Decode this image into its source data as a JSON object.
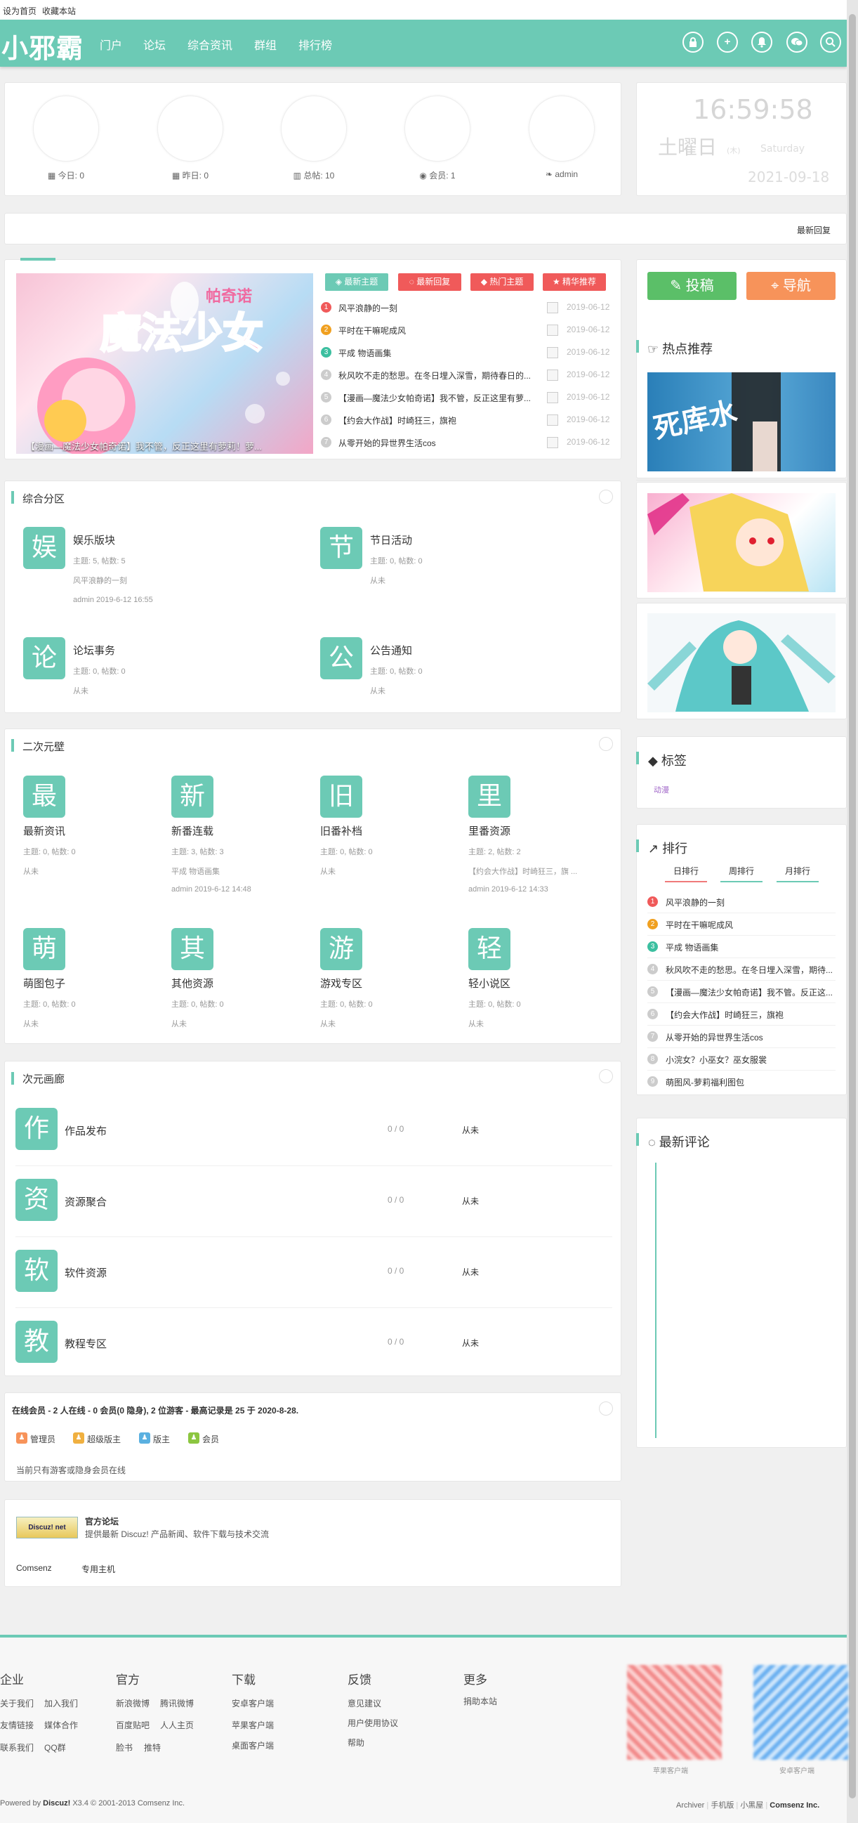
{
  "topbar": {
    "set_home": "设为首页",
    "bookmark": "收藏本站"
  },
  "header": {
    "logo": "小邪霸",
    "nav": [
      "门户",
      "论坛",
      "综合资讯",
      "群组",
      "排行榜"
    ],
    "icons": [
      "lock-icon",
      "plus-icon",
      "bell-icon",
      "chat-icon",
      "search-icon"
    ]
  },
  "stats": {
    "today": "今日: 0",
    "yesterday": "昨日: 0",
    "posts": "总帖: 10",
    "members": "会员: 1",
    "newest": "admin"
  },
  "clock": {
    "time": "16:59:58",
    "weekday_cn": "土曜日",
    "weekday_en": "Saturday",
    "paren": "(木)",
    "date": "2021-09-18"
  },
  "latest_reply_bar": {
    "label": "最新回复"
  },
  "hot_tabs": [
    "最新主题",
    "最新回复",
    "热门主题",
    "精华推荐"
  ],
  "banner": {
    "caption": "【漫画—魔法少女帕奇诺】我不管，反正这里有萝莉！萝..."
  },
  "hot_list": [
    {
      "title": "风平浪静的一刻",
      "date": "2019-06-12"
    },
    {
      "title": "平时在干嘛呢成风",
      "date": "2019-06-12"
    },
    {
      "title": "平成 物语画集",
      "date": "2019-06-12"
    },
    {
      "title": "秋风吹不走的愁思。在冬日埋入深雪，期待春日的...",
      "date": "2019-06-12"
    },
    {
      "title": "【漫画—魔法少女帕奇诺】我不管，反正这里有萝...",
      "date": "2019-06-12"
    },
    {
      "title": "【约会大作战】时崎狂三，旗袍",
      "date": "2019-06-12"
    },
    {
      "title": "从零开始的异世界生活cos",
      "date": "2019-06-12"
    }
  ],
  "section1": {
    "title": "综合分区",
    "forums": [
      {
        "icon": "娱",
        "name": "娱乐版块",
        "meta": "主题: 5, 帖数: 5",
        "last": "风平浪静的一刻",
        "by": "admin 2019-6-12 16:55"
      },
      {
        "icon": "节",
        "name": "节日活动",
        "meta": "主题: 0, 帖数: 0",
        "last": "从未",
        "by": ""
      },
      {
        "icon": "论",
        "name": "论坛事务",
        "meta": "主题: 0, 帖数: 0",
        "last": "从未",
        "by": ""
      },
      {
        "icon": "公",
        "name": "公告通知",
        "meta": "主题: 0, 帖数: 0",
        "last": "从未",
        "by": ""
      }
    ]
  },
  "section2": {
    "title": "二次元壁",
    "forums": [
      {
        "icon": "最",
        "name": "最新资讯",
        "meta": "主题: 0, 帖数: 0",
        "last": "从未",
        "by": ""
      },
      {
        "icon": "新",
        "name": "新番连载",
        "meta": "主题: 3, 帖数: 3",
        "last": "平成 物语画集",
        "by": "admin 2019-6-12 14:48"
      },
      {
        "icon": "旧",
        "name": "旧番补档",
        "meta": "主题: 0, 帖数: 0",
        "last": "从未",
        "by": ""
      },
      {
        "icon": "里",
        "name": "里番资源",
        "meta": "主题: 2, 帖数: 2",
        "last": "【约会大作战】时崎狂三，旗 ...",
        "by": "admin 2019-6-12 14:33"
      },
      {
        "icon": "萌",
        "name": "萌图包子",
        "meta": "主题: 0, 帖数: 0",
        "last": "从未",
        "by": ""
      },
      {
        "icon": "其",
        "name": "其他资源",
        "meta": "主题: 0, 帖数: 0",
        "last": "从未",
        "by": ""
      },
      {
        "icon": "游",
        "name": "游戏专区",
        "meta": "主题: 0, 帖数: 0",
        "last": "从未",
        "by": ""
      },
      {
        "icon": "轻",
        "name": "轻小说区",
        "meta": "主题: 0, 帖数: 0",
        "last": "从未",
        "by": ""
      }
    ]
  },
  "section3": {
    "title": "次元画廊",
    "forums": [
      {
        "icon": "作",
        "name": "作品发布",
        "count": "0 / 0",
        "last": "从未"
      },
      {
        "icon": "资",
        "name": "资源聚合",
        "count": "0 / 0",
        "last": "从未"
      },
      {
        "icon": "软",
        "name": "软件资源",
        "count": "0 / 0",
        "last": "从未"
      },
      {
        "icon": "教",
        "name": "教程专区",
        "count": "0 / 0",
        "last": "从未"
      }
    ]
  },
  "online": {
    "summary": "在线会员 - 2 人在线 - 0 会员(0 隐身), 2 位游客 - 最高记录是 25 于 2020-8-28.",
    "legend": [
      "管理员",
      "超级版主",
      "版主",
      "会员"
    ],
    "note": "当前只有游客或隐身会员在线"
  },
  "links": {
    "logo_text": "Discuz! net",
    "official_title": "官方论坛",
    "official_desc": "提供最新 Discuz! 产品新闻、软件下载与技术交流",
    "items": [
      "Comsenz",
      "专用主机"
    ]
  },
  "right": {
    "post_btn": "投稿",
    "nav_btn": "导航",
    "hot_title": "热点推荐",
    "tags_title": "标签",
    "tag": "动漫",
    "rank_title": "排行",
    "rank_tabs": [
      "日排行",
      "周排行",
      "月排行"
    ],
    "rank_list": [
      "风平浪静的一刻",
      "平时在干嘛呢成风",
      "平成 物语画集",
      "秋风吹不走的愁思。在冬日埋入深雪，期待...",
      "【漫画—魔法少女帕奇诺】我不管。反正这...",
      "【约会大作战】时崎狂三，旗袍",
      "从零开始的异世界生活cos",
      "小浣女？小巫女？巫女服裳",
      "萌图风-萝莉福利图包"
    ],
    "comment_title": "最新评论"
  },
  "footer": {
    "cols": [
      {
        "title": "企业",
        "links": [
          "关于我们",
          "加入我们",
          "友情链接",
          "媒体合作",
          "联系我们",
          "QQ群"
        ]
      },
      {
        "title": "官方",
        "links": [
          "新浪微博",
          "腾讯微博",
          "百度贴吧",
          "人人主页",
          "脸书",
          "推特"
        ]
      },
      {
        "title": "下载",
        "links": [
          "安卓客户端",
          "苹果客户端",
          "桌面客户端"
        ]
      },
      {
        "title": "反馈",
        "links": [
          "意见建议",
          "用户使用协议",
          "帮助"
        ]
      },
      {
        "title": "更多",
        "links": [
          "捐助本站"
        ]
      }
    ],
    "qr_labels": [
      "苹果客户端",
      "安卓客户端"
    ],
    "copyright_prefix": "Powered by",
    "copyright_brand": "Discuz!",
    "copyright_rest": "X3.4 © 2001-2013 Comsenz Inc.",
    "bottom_links": [
      "Archiver",
      "手机版",
      "小黑屋",
      "Comsenz Inc."
    ]
  },
  "colors": {
    "accent": "#6ccab5",
    "red": "#f05a5a",
    "orange": "#f7935a",
    "green": "#5bbf68"
  }
}
